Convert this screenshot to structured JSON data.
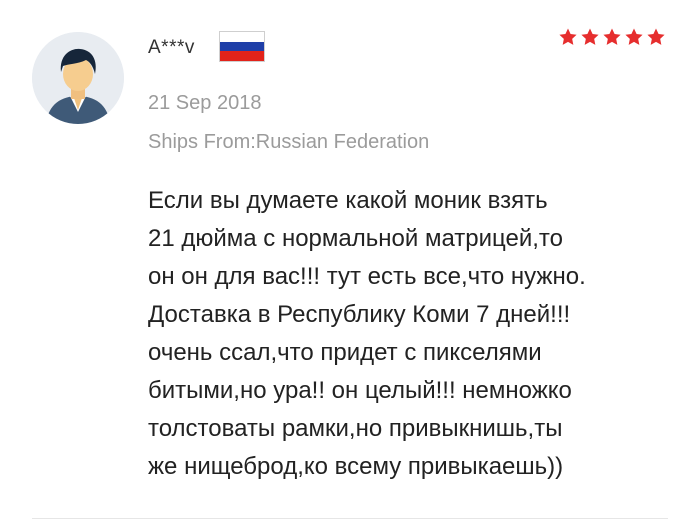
{
  "review": {
    "username": "A***v",
    "country_flag": "russia-flag-icon",
    "rating": 5,
    "rating_max": 5,
    "star_color": "#e62e2e",
    "date": "21 Sep 2018",
    "ships_from": "Ships From:Russian Federation",
    "text_lines": [
      "Если вы думаете какой моник взять",
      "21 дюйма с нормальной матрицей,то",
      "он он для вас!!! тут есть все,что нужно.",
      "Доставка в Республику Коми 7 дней!!!",
      "очень ссал,что придет с пикселями",
      "битыми,но ура!! он целый!!! немножко",
      "толстоваты рамки,но привыкнишь,ты",
      "же нищеброд,ко всему привыкаешь))"
    ]
  }
}
